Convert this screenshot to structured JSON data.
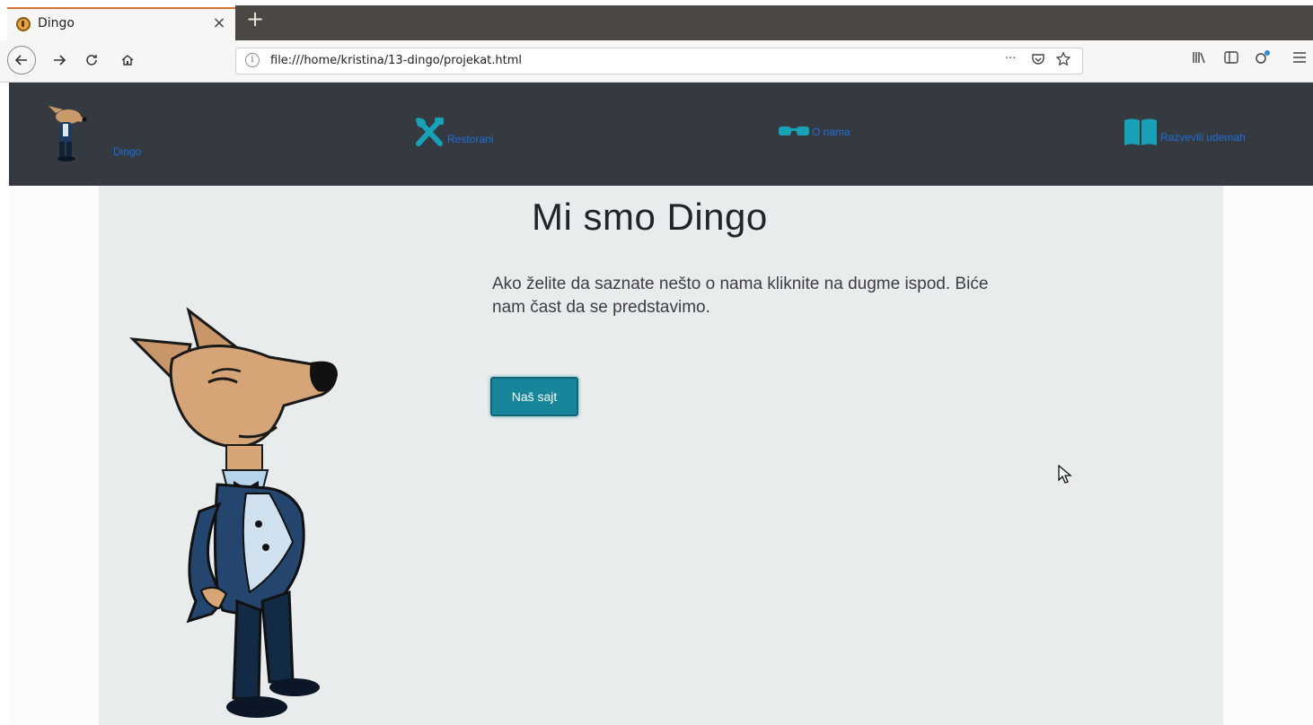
{
  "browser": {
    "tab_title": "Dingo",
    "tab_close": "×",
    "new_tab": "+",
    "url": "file:///home/kristina/13-dingo/projekat.html",
    "page_actions": "···"
  },
  "site": {
    "nav": [
      {
        "label": "Dingo",
        "icon": "dingo-logo-icon"
      },
      {
        "label": "Restorani",
        "icon": "utensils-icon"
      },
      {
        "label": "O nama",
        "icon": "glasses-icon"
      },
      {
        "label": "Razvevili udemah",
        "icon": "book-icon"
      }
    ],
    "hero": {
      "title": "Mi smo Dingo",
      "text": "Ako želite da saznate nešto o nama kliknite na dugme ispod. Biće nam čast da se predstavimo.",
      "button": "Naš sajt"
    }
  },
  "colors": {
    "header_bg": "#343a40",
    "nav_link": "#1e6fd9",
    "nav_icon": "#17a2b8",
    "button_bg": "#17869a",
    "content_bg": "#e9ecec",
    "tab_accent": "#d87234"
  }
}
